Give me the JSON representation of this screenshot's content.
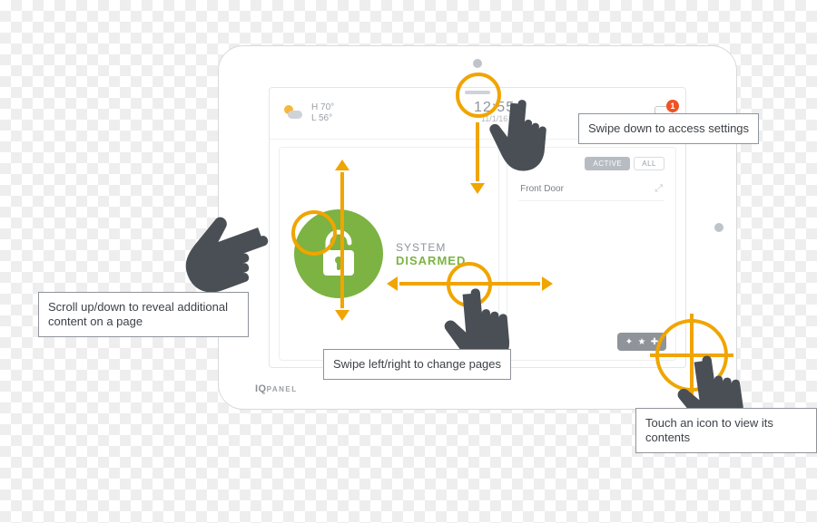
{
  "brand": {
    "prefix": "IQ",
    "suffix": "PANEL"
  },
  "header": {
    "weather": {
      "hi_label": "H",
      "hi": "70°",
      "lo_label": "L",
      "lo": "56°"
    },
    "clock": {
      "time": "12:55",
      "date": "11/1/16"
    },
    "messages": {
      "unread": "1"
    },
    "handle_name": "swipe-down-handle"
  },
  "status": {
    "label": "SYSTEM",
    "value": "DISARMED"
  },
  "sensors": {
    "filter": {
      "active": "ACTIVE",
      "all": "ALL"
    },
    "items": [
      {
        "name": "Front Door",
        "state": "⤢"
      }
    ]
  },
  "quick_actions": {
    "icons": [
      "shield-icon",
      "lock-icon",
      "plus-icon"
    ]
  },
  "callouts": {
    "swipe_down": "Swipe down to access settings",
    "scroll": "Scroll up/down to reveal additional content on a page",
    "swipe_lr": "Swipe left/right to change pages",
    "touch": "Touch an icon to view its contents"
  }
}
